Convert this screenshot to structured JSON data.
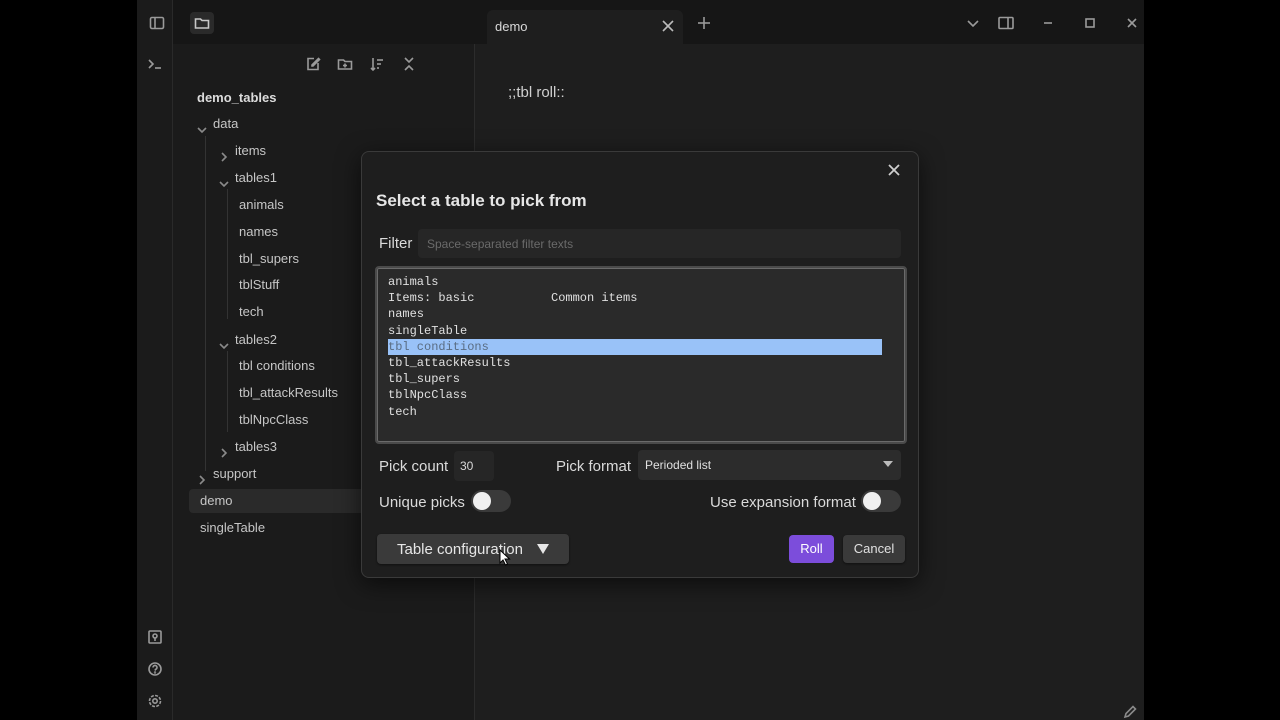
{
  "vault": {
    "name": "demo_tables"
  },
  "tree": [
    {
      "label": "data",
      "level": 0,
      "expanded": true
    },
    {
      "label": "items",
      "level": 1,
      "expanded": false
    },
    {
      "label": "tables1",
      "level": 1,
      "expanded": true
    },
    {
      "label": "animals",
      "level": 2
    },
    {
      "label": "names",
      "level": 2
    },
    {
      "label": "tbl_supers",
      "level": 2
    },
    {
      "label": "tblStuff",
      "level": 2
    },
    {
      "label": "tech",
      "level": 2
    },
    {
      "label": "tables2",
      "level": 1,
      "expanded": true
    },
    {
      "label": "tbl conditions",
      "level": 2
    },
    {
      "label": "tbl_attackResults",
      "level": 2
    },
    {
      "label": "tblNpcClass",
      "level": 2
    },
    {
      "label": "tables3",
      "level": 1,
      "expanded": false
    },
    {
      "label": "support",
      "level": 0,
      "expanded": false
    },
    {
      "label": "demo",
      "level": 0,
      "active": true
    },
    {
      "label": "singleTable",
      "level": 0
    }
  ],
  "tab": {
    "title": "demo"
  },
  "editor": {
    "line1": ";;tbl roll::"
  },
  "modal": {
    "title": "Select a table to pick from",
    "filter_label": "Filter",
    "filter_placeholder": "Space-separated filter texts",
    "filter_value": "",
    "tables": [
      {
        "name": "animals",
        "desc": ""
      },
      {
        "name": "Items: basic",
        "desc": "Common items"
      },
      {
        "name": "names",
        "desc": ""
      },
      {
        "name": "singleTable",
        "desc": ""
      },
      {
        "name": "tbl conditions",
        "desc": "",
        "selected": true
      },
      {
        "name": "tbl_attackResults",
        "desc": ""
      },
      {
        "name": "tbl_supers",
        "desc": ""
      },
      {
        "name": "tblNpcClass",
        "desc": ""
      },
      {
        "name": "tech",
        "desc": ""
      }
    ],
    "pick_count_label": "Pick count",
    "pick_count_value": "30",
    "pick_format_label": "Pick format",
    "pick_format_value": "Perioded list",
    "unique_picks_label": "Unique picks",
    "unique_picks_on": false,
    "expansion_label": "Use expansion format",
    "expansion_on": false,
    "config_button_label": "Table configuration",
    "roll_label": "Roll",
    "cancel_label": "Cancel"
  },
  "colors": {
    "accent": "#7c4ddb",
    "selection": "#99c2f8",
    "background": "#1e1e1e"
  },
  "icons": {
    "ribbon": [
      "terminal-icon",
      "open-vault-icon",
      "help-icon",
      "settings-icon"
    ],
    "sidebar_tabs": [
      "sidebar-toggle-icon",
      "folder-icon"
    ],
    "nav_actions": [
      "new-note-icon",
      "new-folder-icon",
      "sort-icon",
      "collapse-all-icon"
    ]
  }
}
